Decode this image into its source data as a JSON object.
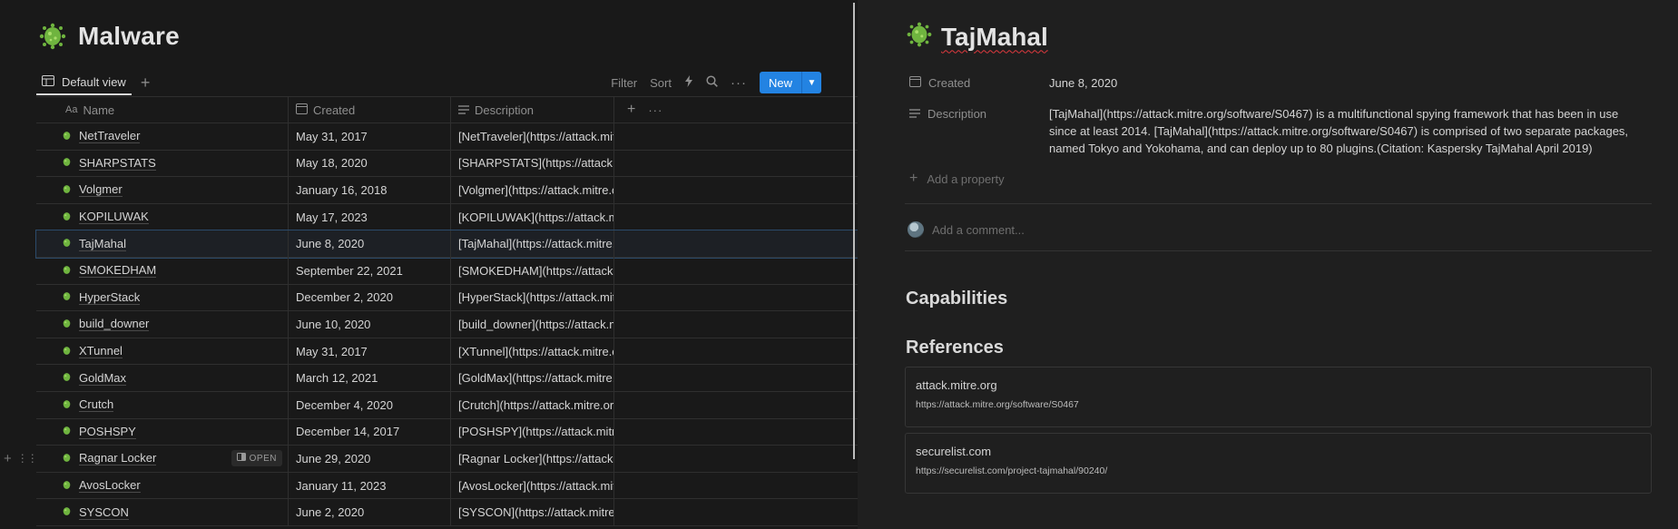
{
  "database": {
    "title": "Malware",
    "view_label": "Default view",
    "actions": {
      "filter": "Filter",
      "sort": "Sort",
      "new": "New"
    },
    "columns": {
      "name": "Name",
      "created": "Created",
      "description": "Description"
    },
    "rows": [
      {
        "name": "NetTraveler",
        "created": "May 31, 2017",
        "description": "[NetTraveler](https://attack.mitre"
      },
      {
        "name": "SHARPSTATS",
        "created": "May 18, 2020",
        "description": "[SHARPSTATS](https://attack.mitre"
      },
      {
        "name": "Volgmer",
        "created": "January 16, 2018",
        "description": "[Volgmer](https://attack.mitre.org"
      },
      {
        "name": "KOPILUWAK",
        "created": "May 17, 2023",
        "description": "[KOPILUWAK](https://attack.mitre"
      },
      {
        "name": "TajMahal",
        "created": "June 8, 2020",
        "description": "[TajMahal](https://attack.mitre.org"
      },
      {
        "name": "SMOKEDHAM",
        "created": "September 22, 2021",
        "description": "[SMOKEDHAM](https://attack.mitre"
      },
      {
        "name": "HyperStack",
        "created": "December 2, 2020",
        "description": "[HyperStack](https://attack.mitre"
      },
      {
        "name": "build_downer",
        "created": "June 10, 2020",
        "description": "[build_downer](https://attack.mitre"
      },
      {
        "name": "XTunnel",
        "created": "May 31, 2017",
        "description": "[XTunnel](https://attack.mitre.org"
      },
      {
        "name": "GoldMax",
        "created": "March 12, 2021",
        "description": "[GoldMax](https://attack.mitre.org"
      },
      {
        "name": "Crutch",
        "created": "December 4, 2020",
        "description": "[Crutch](https://attack.mitre.org"
      },
      {
        "name": "POSHSPY",
        "created": "December 14, 2017",
        "description": "[POSHSPY](https://attack.mitre.org"
      },
      {
        "name": "Ragnar Locker",
        "created": "June 29, 2020",
        "description": "[Ragnar Locker](https://attack.mitre",
        "open_label": "OPEN"
      },
      {
        "name": "AvosLocker",
        "created": "January 11, 2023",
        "description": "[AvosLocker](https://attack.mitre"
      },
      {
        "name": "SYSCON",
        "created": "June 2, 2020",
        "description": "[SYSCON](https://attack.mitre.org"
      }
    ]
  },
  "page": {
    "title": "TajMahal",
    "props": {
      "created_label": "Created",
      "created_value": "June 8, 2020",
      "description_label": "Description",
      "description_value": "[TajMahal](https://attack.mitre.org/software/S0467) is a multifunctional spying framework that has been in use since at least 2014. [TajMahal](https://attack.mitre.org/software/S0467) is comprised of two separate packages, named Tokyo and Yokohama, and can deploy up to 80 plugins.(Citation: Kaspersky TajMahal April 2019)"
    },
    "add_property": "Add a property",
    "comment_placeholder": "Add a comment...",
    "capabilities_heading": "Capabilities",
    "references_heading": "References",
    "references": [
      {
        "title": "attack.mitre.org",
        "url": "https://attack.mitre.org/software/S0467"
      },
      {
        "title": "securelist.com",
        "url": "https://securelist.com/project-tajmahal/90240/"
      }
    ]
  },
  "colors": {
    "accent": "#2383e2",
    "icon_green": "#7cc24a",
    "background": "#191919",
    "peek_background": "#1f1f1f"
  }
}
